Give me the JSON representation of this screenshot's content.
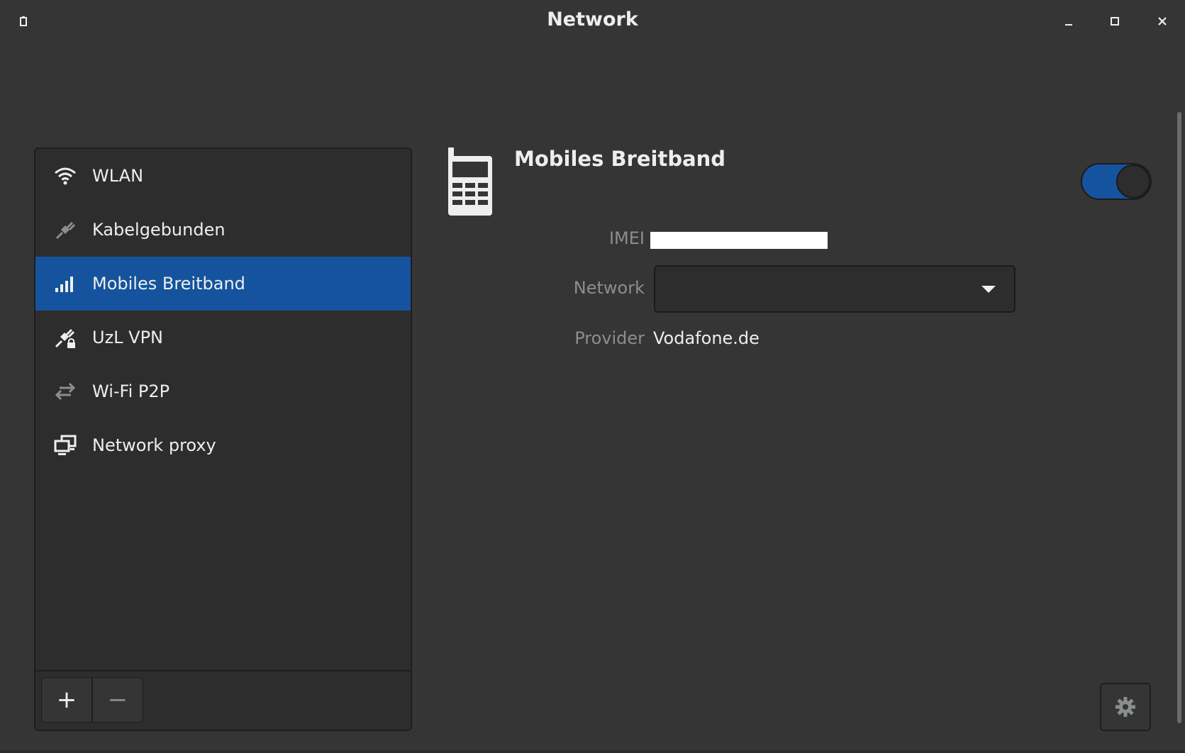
{
  "window": {
    "title": "Network"
  },
  "sidebar": {
    "items": [
      {
        "label": "WLAN",
        "icon": "wifi-icon",
        "selected": false
      },
      {
        "label": "Kabelgebunden",
        "icon": "ethernet-plug-icon",
        "selected": false
      },
      {
        "label": "Mobiles Breitband",
        "icon": "cellular-signal-icon",
        "selected": true
      },
      {
        "label": "UzL VPN",
        "icon": "vpn-lock-icon",
        "selected": false
      },
      {
        "label": "Wi-Fi P2P",
        "icon": "p2p-arrows-icon",
        "selected": false
      },
      {
        "label": "Network proxy",
        "icon": "proxy-computers-icon",
        "selected": false
      }
    ],
    "add_label": "+",
    "remove_label": "−"
  },
  "detail": {
    "title": "Mobiles Breitband",
    "toggle_on": true,
    "imei_label": "IMEI",
    "imei_value": "",
    "network_label": "Network",
    "network_value": "",
    "provider_label": "Provider",
    "provider_value": "Vodafone.de"
  },
  "colors": {
    "accent": "#15539e",
    "window_bg": "#353535",
    "sidebar_bg": "#2d2d2d",
    "text": "#eeeeec",
    "dim_text": "#8b8e8f"
  }
}
